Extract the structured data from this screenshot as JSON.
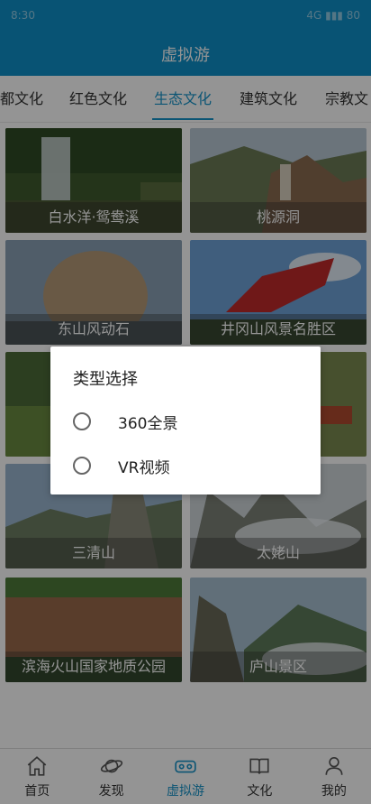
{
  "status_bar": {
    "time": "8:30",
    "icons": "4G ▮▮▮ 80"
  },
  "header": {
    "title": "虚拟游"
  },
  "tabs": [
    {
      "label": "都文化"
    },
    {
      "label": "红色文化"
    },
    {
      "label": "生态文化"
    },
    {
      "label": "建筑文化"
    },
    {
      "label": "宗教文"
    }
  ],
  "active_tab": "生态文化",
  "cards": [
    {
      "caption": "白水洋·鸳鸯溪"
    },
    {
      "caption": "桃源洞"
    },
    {
      "caption": "东山风动石"
    },
    {
      "caption": "井冈山风景名胜区"
    },
    {
      "caption": ""
    },
    {
      "caption": ""
    },
    {
      "caption": "三清山"
    },
    {
      "caption": "太姥山"
    },
    {
      "caption": "滨海火山国家地质公园"
    },
    {
      "caption": "庐山景区"
    }
  ],
  "dialog": {
    "title": "类型选择",
    "options": [
      {
        "label": "360全景"
      },
      {
        "label": "VR视频"
      }
    ]
  },
  "bottom_nav": [
    {
      "label": "首页",
      "icon": "home-icon"
    },
    {
      "label": "发现",
      "icon": "planet-icon"
    },
    {
      "label": "虚拟游",
      "icon": "vr-goggles-icon"
    },
    {
      "label": "文化",
      "icon": "book-icon"
    },
    {
      "label": "我的",
      "icon": "person-icon"
    }
  ],
  "colors": {
    "primary": "#0e8fc8",
    "active_tab": "#1693c9",
    "overlay": "rgba(0,0,0,0.42)"
  }
}
